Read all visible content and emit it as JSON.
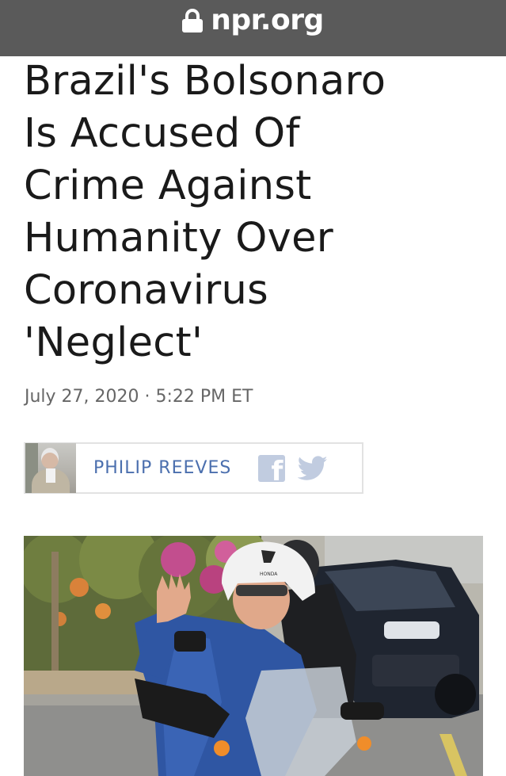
{
  "browser": {
    "url": "npr.org",
    "icon": "lock-icon"
  },
  "article": {
    "headline_lines": [
      "Brazil's Bolsonaro",
      "Is Accused Of",
      "Crime Against",
      "Humanity Over",
      "Coronavirus",
      "'Neglect'"
    ],
    "dateline": "July 27, 2020 · 5:22 PM ET",
    "byline": {
      "author": "PHILIP REEVES",
      "avatar_icon": "author-photo",
      "share_icons": [
        "facebook-icon",
        "twitter-icon"
      ]
    },
    "image": {
      "helmet_brand": "HONDA"
    }
  },
  "colors": {
    "url_bar": "#5a5a5a",
    "author_link": "#4b6fae",
    "share_icon": "#c1cce0"
  }
}
